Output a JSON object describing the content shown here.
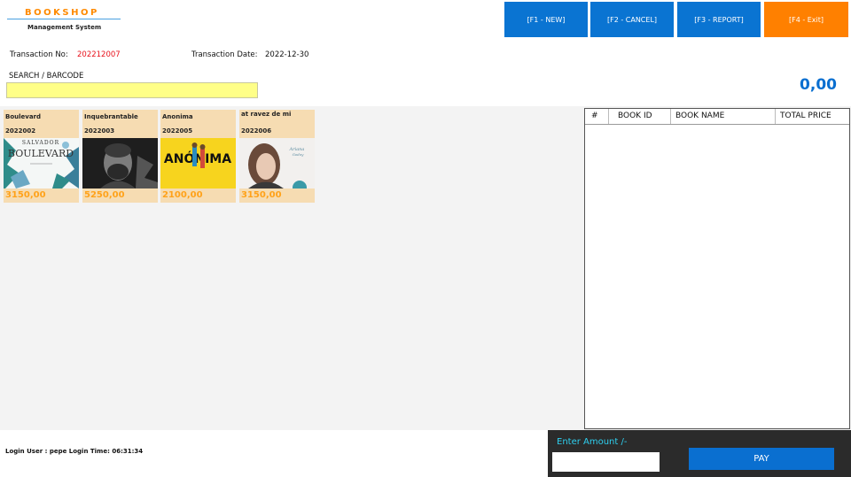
{
  "header": {
    "logo_title": "BOOKSHOP",
    "logo_subtitle": "Management System"
  },
  "toolbar": {
    "new_label": "[F1 - NEW]",
    "cancel_label": "[F2 - CANCEL]",
    "report_label": "[F3 - REPORT]",
    "exit_label": "[F4 - Exit]"
  },
  "transaction": {
    "no_label": "Transaction No:",
    "no_value": "202212007",
    "date_label": "Transaction Date:",
    "date_value": "2022-12-30"
  },
  "search": {
    "label": "SEARCH / BARCODE",
    "value": ""
  },
  "total": "0,00",
  "books": [
    {
      "title": "Boulevard",
      "id": "2022002",
      "price": "3150,00",
      "cover": "boulevard-cover"
    },
    {
      "title": "Inquebrantable",
      "id": "2022003",
      "price": "5250,00",
      "cover": "inquebrantable-cover"
    },
    {
      "title": "Anonima",
      "id": "2022005",
      "price": "2100,00",
      "cover": "anonima-cover"
    },
    {
      "title": "at ravez de mi",
      "id": "2022006",
      "price": "3150,00",
      "cover": "at-ravez-de-mi-cover"
    }
  ],
  "cover_art": {
    "boulevard": {
      "top_text": "SALVADOR",
      "main_text": "BOULEVARD"
    },
    "anonima": {
      "main_text": "ANÓNIMA"
    }
  },
  "cart": {
    "columns": [
      "#",
      "BOOK ID",
      "BOOK NAME",
      "TOTAL PRICE"
    ],
    "rows": []
  },
  "footer": {
    "login_info": "Login User : pepe Login Time: 06:31:34",
    "amount_label": "Enter Amount /-",
    "amount_value": "",
    "pay_label": "PAY"
  },
  "colors": {
    "accent_blue": "#0a74d2",
    "exit_orange": "#ff8000",
    "card_bg": "#f6dcb2",
    "price_orange": "#ffa21a",
    "search_yellow": "#ffff88"
  }
}
